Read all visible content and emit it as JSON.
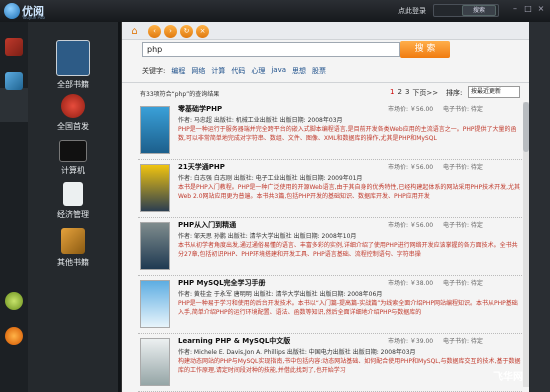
{
  "app": {
    "logo_text": "优阅",
    "logo_sub": "Youyue Pub",
    "login": "点此登录",
    "top_search_btn": "搜索"
  },
  "window_buttons": [
    "–",
    "□",
    "×"
  ],
  "categories": [
    {
      "label": "全部书籍",
      "active": true
    },
    {
      "label": "全国首发",
      "active": false
    },
    {
      "label": "计算机",
      "active": false
    },
    {
      "label": "经济管理",
      "active": false
    },
    {
      "label": "其他书籍",
      "active": false
    }
  ],
  "search": {
    "value": "php",
    "button": "搜 索"
  },
  "keywords": {
    "label": "关键字:",
    "items": [
      "编程",
      "网络",
      "计算",
      "代码",
      "心理",
      "java",
      "思想",
      "股票"
    ]
  },
  "results": {
    "summary": "有33项符合“php”的查询结果",
    "pager": {
      "current": "1",
      "pages": [
        "2",
        "3"
      ],
      "next": "下页>>"
    },
    "sort_label": "排序:",
    "sort_value": "按最近更新"
  },
  "books": [
    {
      "title": "零基础学PHP",
      "meta": "作者: 马忠超    出版社: 机械工业出版社    出版日期: 2008年03月",
      "desc": "PHP是一种运行于服务器端并完全跨平台的嵌入式脚本编程语言,是目前开发各类Web应用的主流语言之一。PHP提供了大量的函数,可以非常简单地完成对字符串、数组、文件、图像、XML和数据库的操作,尤其是PHP和MySQL",
      "price": "市场价: ￥56.00",
      "ebook": "电子书价: 待定"
    },
    {
      "title": "21天学通PHP",
      "meta": "作者: 白志强 白志刚    出版社: 电子工业出版社    出版日期: 2009年01月",
      "desc": "本书是PHP入门教程。PHP是一种广泛使用的开源Web语言,由于其自身的优秀特性,已经构建起体系的网站采用PHP技术开发,尤其Web 2.0网站应用更为普遍。本书共3篇,包括PHP开发的基础知识、数据库开发、PHP应用开发",
      "price": "市场价: ￥56.00",
      "ebook": "电子书价: 待定"
    },
    {
      "title": "PHP从入门到精通",
      "meta": "作者: 邹天思 孙鹏    出版社: 清华大学出版社    出版日期: 2008年10月",
      "desc": "本书从初学者角度出发,通过通俗易懂的语言、丰富多彩的实例,详细介绍了使用PHP进行网络开发应该掌握的各方面技术。全书共分27章,包括初识PHP、PHP环境搭建和开发工具、PHP语言基础、流程控制语句、字符串操",
      "price": "市场价: ￥56.00",
      "ebook": "电子书价: 待定"
    },
    {
      "title": "PHP MySQL完全学习手册",
      "meta": "作者: 黄桂金 于永军 唐明明    出版社: 清华大学出版社    出版日期: 2008年06月",
      "desc": "PHP是一种易于学习和使用的后台开发技术。本书以“入门篇-提高篇-实战篇”为线索全面介绍PHP网站编程知识。本书从PHP基础入手,简单介绍PHP的运行环境配置、语法、函数等知识,然后全面详细地介绍PHP与数据库的",
      "price": "市场价: ￥38.00",
      "ebook": "电子书价: 待定"
    },
    {
      "title": "Learning PHP & MySQL中文版",
      "meta": "作者: Michele E. Davis,Jon A. Phillips    出版社: 中国电力出版社    出版日期: 2008年03月",
      "desc": "构建动态网站的PHP与MySQL实现指南,书中包括内容:动态网站基础、如何配合使用PHP和MySQL,与数据库交互的技术,基于数据库的工作原理,请定时间段对种的技能,并借此找到了,也开始学习",
      "price": "市场价: ￥39.00",
      "ebook": "电子书价: 待定"
    }
  ],
  "watermark": "飞华网"
}
